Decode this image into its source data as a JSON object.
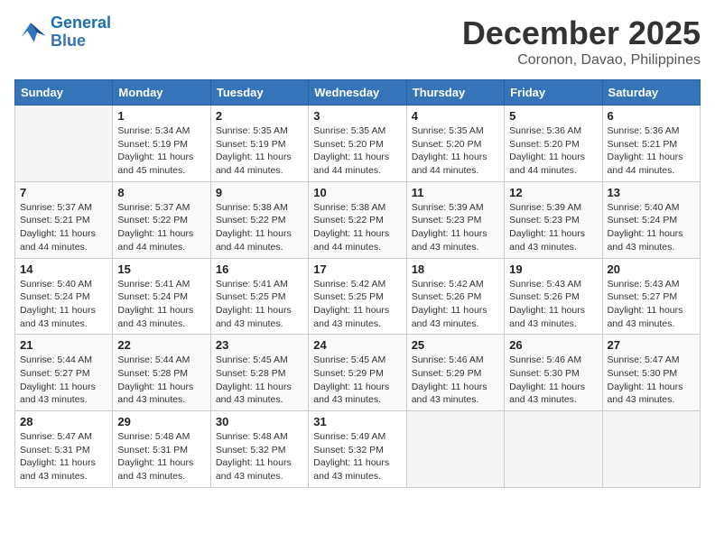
{
  "logo": {
    "line1": "General",
    "line2": "Blue"
  },
  "title": "December 2025",
  "subtitle": "Coronon, Davao, Philippines",
  "days_of_week": [
    "Sunday",
    "Monday",
    "Tuesday",
    "Wednesday",
    "Thursday",
    "Friday",
    "Saturday"
  ],
  "weeks": [
    [
      {
        "day": "",
        "sunrise": "",
        "sunset": "",
        "daylight": ""
      },
      {
        "day": "1",
        "sunrise": "Sunrise: 5:34 AM",
        "sunset": "Sunset: 5:19 PM",
        "daylight": "Daylight: 11 hours and 45 minutes."
      },
      {
        "day": "2",
        "sunrise": "Sunrise: 5:35 AM",
        "sunset": "Sunset: 5:19 PM",
        "daylight": "Daylight: 11 hours and 44 minutes."
      },
      {
        "day": "3",
        "sunrise": "Sunrise: 5:35 AM",
        "sunset": "Sunset: 5:20 PM",
        "daylight": "Daylight: 11 hours and 44 minutes."
      },
      {
        "day": "4",
        "sunrise": "Sunrise: 5:35 AM",
        "sunset": "Sunset: 5:20 PM",
        "daylight": "Daylight: 11 hours and 44 minutes."
      },
      {
        "day": "5",
        "sunrise": "Sunrise: 5:36 AM",
        "sunset": "Sunset: 5:20 PM",
        "daylight": "Daylight: 11 hours and 44 minutes."
      },
      {
        "day": "6",
        "sunrise": "Sunrise: 5:36 AM",
        "sunset": "Sunset: 5:21 PM",
        "daylight": "Daylight: 11 hours and 44 minutes."
      }
    ],
    [
      {
        "day": "7",
        "sunrise": "Sunrise: 5:37 AM",
        "sunset": "Sunset: 5:21 PM",
        "daylight": "Daylight: 11 hours and 44 minutes."
      },
      {
        "day": "8",
        "sunrise": "Sunrise: 5:37 AM",
        "sunset": "Sunset: 5:22 PM",
        "daylight": "Daylight: 11 hours and 44 minutes."
      },
      {
        "day": "9",
        "sunrise": "Sunrise: 5:38 AM",
        "sunset": "Sunset: 5:22 PM",
        "daylight": "Daylight: 11 hours and 44 minutes."
      },
      {
        "day": "10",
        "sunrise": "Sunrise: 5:38 AM",
        "sunset": "Sunset: 5:22 PM",
        "daylight": "Daylight: 11 hours and 44 minutes."
      },
      {
        "day": "11",
        "sunrise": "Sunrise: 5:39 AM",
        "sunset": "Sunset: 5:23 PM",
        "daylight": "Daylight: 11 hours and 43 minutes."
      },
      {
        "day": "12",
        "sunrise": "Sunrise: 5:39 AM",
        "sunset": "Sunset: 5:23 PM",
        "daylight": "Daylight: 11 hours and 43 minutes."
      },
      {
        "day": "13",
        "sunrise": "Sunrise: 5:40 AM",
        "sunset": "Sunset: 5:24 PM",
        "daylight": "Daylight: 11 hours and 43 minutes."
      }
    ],
    [
      {
        "day": "14",
        "sunrise": "Sunrise: 5:40 AM",
        "sunset": "Sunset: 5:24 PM",
        "daylight": "Daylight: 11 hours and 43 minutes."
      },
      {
        "day": "15",
        "sunrise": "Sunrise: 5:41 AM",
        "sunset": "Sunset: 5:24 PM",
        "daylight": "Daylight: 11 hours and 43 minutes."
      },
      {
        "day": "16",
        "sunrise": "Sunrise: 5:41 AM",
        "sunset": "Sunset: 5:25 PM",
        "daylight": "Daylight: 11 hours and 43 minutes."
      },
      {
        "day": "17",
        "sunrise": "Sunrise: 5:42 AM",
        "sunset": "Sunset: 5:25 PM",
        "daylight": "Daylight: 11 hours and 43 minutes."
      },
      {
        "day": "18",
        "sunrise": "Sunrise: 5:42 AM",
        "sunset": "Sunset: 5:26 PM",
        "daylight": "Daylight: 11 hours and 43 minutes."
      },
      {
        "day": "19",
        "sunrise": "Sunrise: 5:43 AM",
        "sunset": "Sunset: 5:26 PM",
        "daylight": "Daylight: 11 hours and 43 minutes."
      },
      {
        "day": "20",
        "sunrise": "Sunrise: 5:43 AM",
        "sunset": "Sunset: 5:27 PM",
        "daylight": "Daylight: 11 hours and 43 minutes."
      }
    ],
    [
      {
        "day": "21",
        "sunrise": "Sunrise: 5:44 AM",
        "sunset": "Sunset: 5:27 PM",
        "daylight": "Daylight: 11 hours and 43 minutes."
      },
      {
        "day": "22",
        "sunrise": "Sunrise: 5:44 AM",
        "sunset": "Sunset: 5:28 PM",
        "daylight": "Daylight: 11 hours and 43 minutes."
      },
      {
        "day": "23",
        "sunrise": "Sunrise: 5:45 AM",
        "sunset": "Sunset: 5:28 PM",
        "daylight": "Daylight: 11 hours and 43 minutes."
      },
      {
        "day": "24",
        "sunrise": "Sunrise: 5:45 AM",
        "sunset": "Sunset: 5:29 PM",
        "daylight": "Daylight: 11 hours and 43 minutes."
      },
      {
        "day": "25",
        "sunrise": "Sunrise: 5:46 AM",
        "sunset": "Sunset: 5:29 PM",
        "daylight": "Daylight: 11 hours and 43 minutes."
      },
      {
        "day": "26",
        "sunrise": "Sunrise: 5:46 AM",
        "sunset": "Sunset: 5:30 PM",
        "daylight": "Daylight: 11 hours and 43 minutes."
      },
      {
        "day": "27",
        "sunrise": "Sunrise: 5:47 AM",
        "sunset": "Sunset: 5:30 PM",
        "daylight": "Daylight: 11 hours and 43 minutes."
      }
    ],
    [
      {
        "day": "28",
        "sunrise": "Sunrise: 5:47 AM",
        "sunset": "Sunset: 5:31 PM",
        "daylight": "Daylight: 11 hours and 43 minutes."
      },
      {
        "day": "29",
        "sunrise": "Sunrise: 5:48 AM",
        "sunset": "Sunset: 5:31 PM",
        "daylight": "Daylight: 11 hours and 43 minutes."
      },
      {
        "day": "30",
        "sunrise": "Sunrise: 5:48 AM",
        "sunset": "Sunset: 5:32 PM",
        "daylight": "Daylight: 11 hours and 43 minutes."
      },
      {
        "day": "31",
        "sunrise": "Sunrise: 5:49 AM",
        "sunset": "Sunset: 5:32 PM",
        "daylight": "Daylight: 11 hours and 43 minutes."
      },
      {
        "day": "",
        "sunrise": "",
        "sunset": "",
        "daylight": ""
      },
      {
        "day": "",
        "sunrise": "",
        "sunset": "",
        "daylight": ""
      },
      {
        "day": "",
        "sunrise": "",
        "sunset": "",
        "daylight": ""
      }
    ]
  ]
}
